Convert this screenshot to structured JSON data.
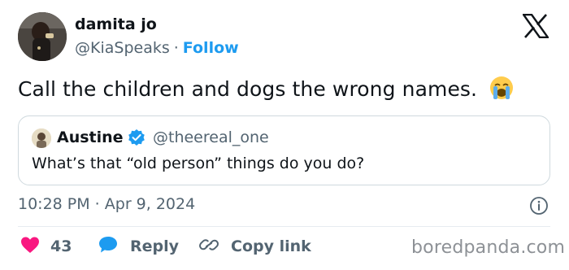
{
  "author": {
    "display_name": "damita jo",
    "handle": "@KiaSpeaks",
    "separator": "·",
    "follow_label": "Follow"
  },
  "tweet": {
    "text": "Call the children and dogs the wrong names.",
    "emoji": "loudly-crying-face",
    "timestamp": "10:28 PM · Apr 9, 2024"
  },
  "quoted_tweet": {
    "display_name": "Austine",
    "handle": "@theereal_one",
    "text": "What’s that “old person” things do you do?"
  },
  "actions": {
    "like_count": "43",
    "reply_label": "Reply",
    "copy_link_label": "Copy link"
  },
  "icons": {
    "brand": "x-logo-icon",
    "info": "info-icon",
    "like": "heart-icon",
    "reply": "reply-bubble-icon",
    "copy": "link-icon",
    "verified": "verified-badge-icon"
  },
  "colors": {
    "accent": "#1d9bf0",
    "like": "#f91880",
    "text_primary": "#0f1419",
    "text_secondary": "#536471",
    "border": "#cfd9de"
  },
  "watermark": "boredpanda.com"
}
